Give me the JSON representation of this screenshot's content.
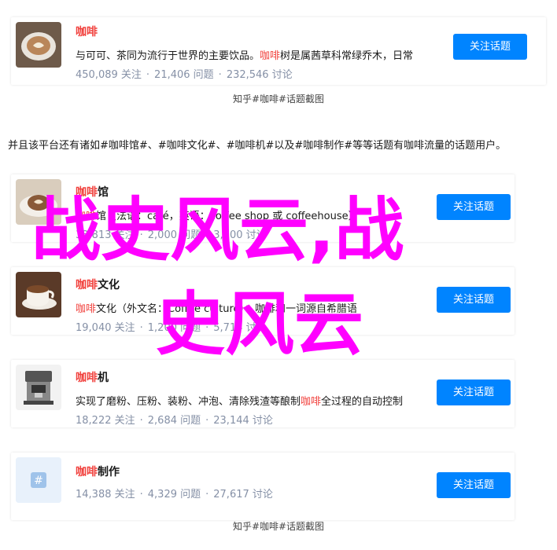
{
  "top_card": {
    "title": "咖啡",
    "desc_pre": "与可可、茶同为流行于世界的主要饮品。",
    "desc_hl": "咖啡",
    "desc_post": "树是属茜草科常绿乔木，日常",
    "followers": "450,089 关注",
    "questions": "21,406 问题",
    "discussions": "232,546 讨论",
    "button": "关注话题"
  },
  "caption_top": "知乎#咖啡#话题截图",
  "paragraph": "并且该平台还有诸如#咖啡馆#、#咖啡文化#、#咖啡机#以及#咖啡制作#等等话题有咖啡流量的话题用户。",
  "topics": [
    {
      "title_hl": "咖啡",
      "title_rest": "馆",
      "desc_hl": "咖啡",
      "desc_rest": "馆（法语：café，英语：coffee shop 或 coffeehouse）",
      "followers": "33,813 关注",
      "questions": "2,000 问题",
      "discussions": "3,000 讨论",
      "button": "关注话题"
    },
    {
      "title_hl": "咖啡",
      "title_rest": "文化",
      "desc_hl": "咖啡",
      "desc_rest": "文化（外文名：Coffee culture）：咖啡和一词源自希腊语",
      "followers": "19,040 关注",
      "questions": "1,200 问题",
      "discussions": "5,714 讨论",
      "button": "关注话题"
    },
    {
      "title_hl": "咖啡",
      "title_rest": "机",
      "desc_pre": "实现了磨粉、压粉、装粉、冲泡、清除残渣等酿制",
      "desc_hl": "咖啡",
      "desc_rest": "全过程的自动控制",
      "followers": "18,222 关注",
      "questions": "2,684 问题",
      "discussions": "23,144 讨论",
      "button": "关注话题"
    },
    {
      "title_hl": "咖啡",
      "title_rest": "制作",
      "followers": "14,388 关注",
      "questions": "4,329 问题",
      "discussions": "27,617 讨论",
      "button": "关注话题"
    }
  ],
  "caption_bottom": "知乎#咖啡#话题截图",
  "overlay": {
    "line1": "战史风云,战",
    "line2": "史风云",
    "color": "#ff00ff"
  },
  "colors": {
    "accent": "#0084ff",
    "highlight": "#f1403c",
    "meta": "#8590a6"
  },
  "icons": [
    "coffee-cup-latte-thumbnail",
    "coffee-cafe-thumbnail",
    "coffee-cup-thumbnail",
    "espresso-machine-thumbnail",
    "topic-hash-icon"
  ]
}
